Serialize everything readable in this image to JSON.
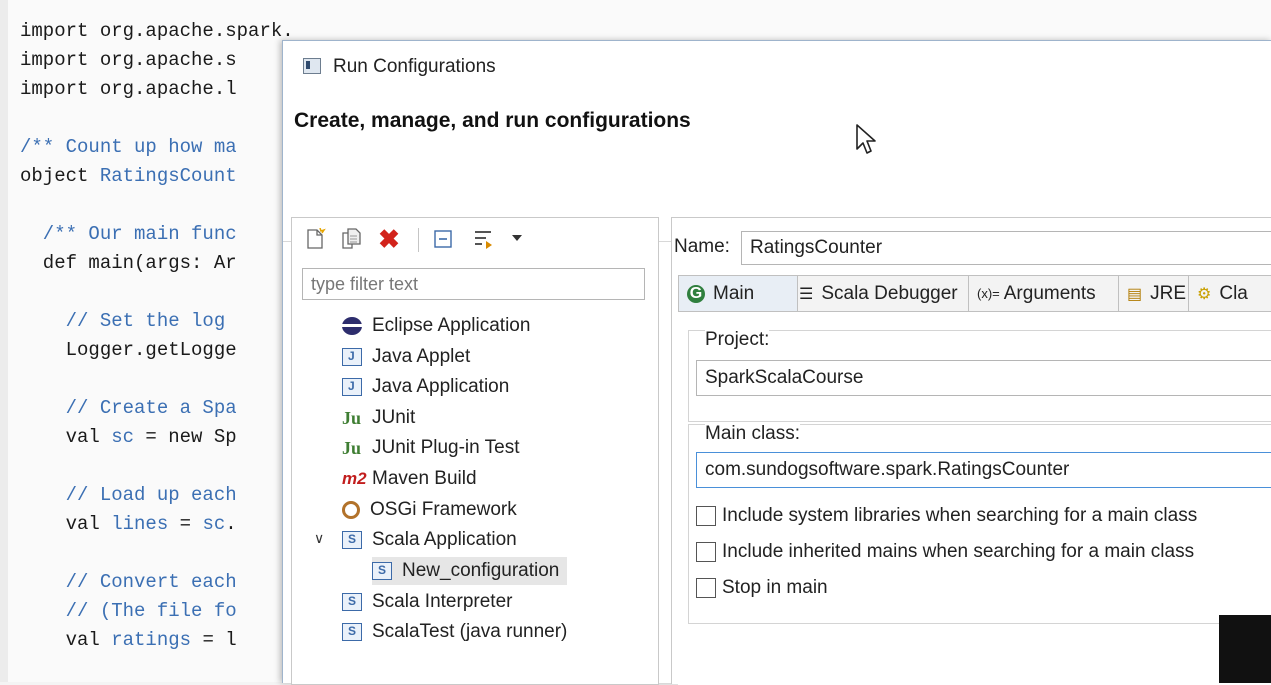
{
  "editor": {
    "lines": [
      [
        {
          "t": "import org.apache.spark.",
          "c": ""
        }
      ],
      [
        {
          "t": "import org.apache.s",
          "c": ""
        }
      ],
      [
        {
          "t": "import org.apache.l",
          "c": ""
        }
      ],
      [
        {
          "t": "",
          "c": ""
        }
      ],
      [
        {
          "t": "/** Count up how ma",
          "c": "c-comment"
        }
      ],
      [
        {
          "t": "object ",
          "c": ""
        },
        {
          "t": "RatingsCount",
          "c": "c-ident"
        }
      ],
      [
        {
          "t": "",
          "c": ""
        }
      ],
      [
        {
          "t": "  /** Our main func",
          "c": "c-comment"
        }
      ],
      [
        {
          "t": "  def main(args: Ar",
          "c": ""
        }
      ],
      [
        {
          "t": "",
          "c": ""
        }
      ],
      [
        {
          "t": "    // Set the log ",
          "c": "c-comment"
        }
      ],
      [
        {
          "t": "    Logger.getLogge",
          "c": ""
        }
      ],
      [
        {
          "t": "",
          "c": ""
        }
      ],
      [
        {
          "t": "    // Create a Spa",
          "c": "c-comment"
        }
      ],
      [
        {
          "t": "    val ",
          "c": ""
        },
        {
          "t": "sc",
          "c": "c-ident"
        },
        {
          "t": " = new Sp",
          "c": ""
        }
      ],
      [
        {
          "t": "",
          "c": ""
        }
      ],
      [
        {
          "t": "    // Load up each",
          "c": "c-comment"
        }
      ],
      [
        {
          "t": "    val ",
          "c": ""
        },
        {
          "t": "lines",
          "c": "c-ident"
        },
        {
          "t": " = ",
          "c": ""
        },
        {
          "t": "sc",
          "c": "c-ident"
        },
        {
          "t": ".",
          "c": ""
        }
      ],
      [
        {
          "t": "",
          "c": ""
        }
      ],
      [
        {
          "t": "    // Convert each",
          "c": "c-comment"
        }
      ],
      [
        {
          "t": "    // (The file fo",
          "c": "c-comment"
        }
      ],
      [
        {
          "t": "    val ",
          "c": ""
        },
        {
          "t": "ratings",
          "c": "c-ident"
        },
        {
          "t": " = l",
          "c": ""
        }
      ]
    ]
  },
  "dialog": {
    "title": "Run Configurations",
    "banner_title": "Create, manage, and run configurations"
  },
  "left": {
    "filter_placeholder": "type filter text",
    "tree": [
      {
        "label": "Eclipse Application",
        "icon": "eclipse-icon"
      },
      {
        "label": "Java Applet",
        "icon": "java-applet-icon"
      },
      {
        "label": "Java Application",
        "icon": "java-application-icon"
      },
      {
        "label": "JUnit",
        "icon": "junit-icon"
      },
      {
        "label": "JUnit Plug-in Test",
        "icon": "junit-plugin-icon"
      },
      {
        "label": "Maven Build",
        "icon": "maven-icon"
      },
      {
        "label": "OSGi Framework",
        "icon": "osgi-icon"
      },
      {
        "label": "Scala Application",
        "icon": "scala-app-icon",
        "expanded": true
      },
      {
        "label": "New_configuration",
        "icon": "scala-config-icon",
        "selected": true
      },
      {
        "label": "Scala Interpreter",
        "icon": "scala-interpreter-icon"
      },
      {
        "label": "ScalaTest (java runner)",
        "icon": "scalatest-icon"
      }
    ]
  },
  "right": {
    "name_label": "Name:",
    "name_value": "RatingsCounter",
    "tabs": [
      {
        "label": "Main",
        "icon": "main-tab-icon",
        "active": true
      },
      {
        "label": "Scala Debugger",
        "icon": "debugger-icon"
      },
      {
        "label": "Arguments",
        "icon": "arguments-icon"
      },
      {
        "label": "JRE",
        "icon": "jre-icon"
      },
      {
        "label": "Cla",
        "icon": "classpath-icon"
      }
    ],
    "project_label": "Project:",
    "project_value": "SparkScalaCourse",
    "main_class_label": "Main class:",
    "main_class_value": "com.sundogsoftware.spark.RatingsCounter",
    "checkboxes": [
      {
        "label": "Include system libraries when searching for a main class",
        "checked": false
      },
      {
        "label": "Include inherited mains when searching for a main class",
        "checked": false
      },
      {
        "label": "Stop in main",
        "checked": false
      }
    ]
  }
}
